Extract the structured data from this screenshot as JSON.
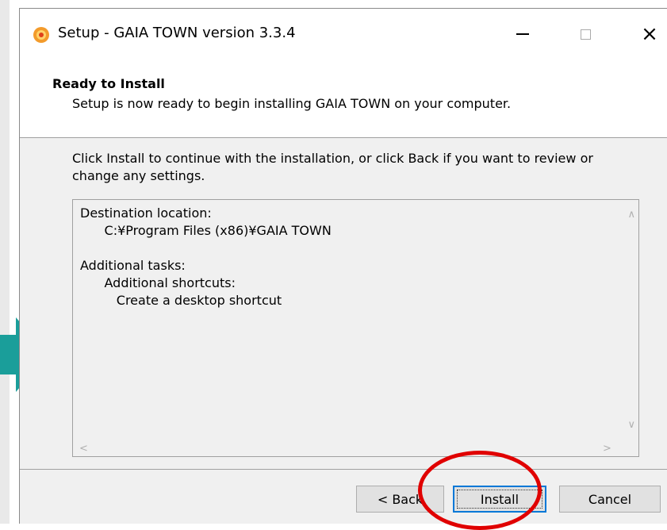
{
  "window": {
    "title": "Setup - GAIA TOWN version 3.3.4",
    "app_icon": "setup-disc-icon",
    "controls": {
      "minimize": "minimize-icon",
      "maximize": "maximize-icon",
      "close": "×"
    }
  },
  "header": {
    "title": "Ready to Install",
    "subtitle": "Setup is now ready to begin installing GAIA TOWN on your computer."
  },
  "instructions": "Click Install to continue with the installation, or click Back if you want to review or change any settings.",
  "memo": {
    "text": "Destination location:\n      C:¥Program Files (x86)¥GAIA TOWN\n\nAdditional tasks:\n      Additional shortcuts:\n         Create a desktop shortcut"
  },
  "scroll_arrows": {
    "up": "∧",
    "down": "∨",
    "left": "<",
    "right": ">"
  },
  "buttons": {
    "back": "< Back",
    "install": "Install",
    "cancel": "Cancel"
  },
  "annotations": {
    "highlight_color": "#e00000",
    "arrow_color": "#1a9e9a",
    "arrow_icon": "arrow-right-icon"
  },
  "colors": {
    "dialog_bg": "#f0f0f0",
    "focus_border": "#0078d7"
  }
}
